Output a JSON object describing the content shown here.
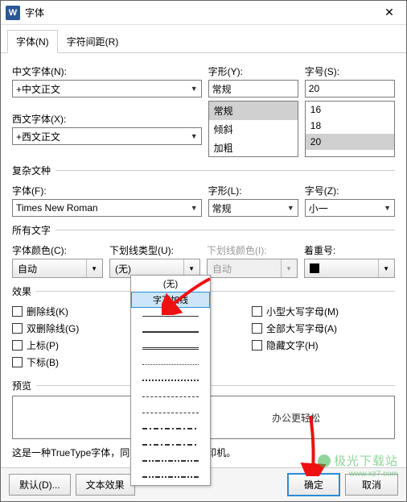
{
  "window": {
    "title": "字体",
    "icon_letter": "W"
  },
  "tabs": [
    {
      "label": "字体(N)",
      "active": true
    },
    {
      "label": "字符间距(R)",
      "active": false
    }
  ],
  "group_main": {
    "cn_font_label": "中文字体(N):",
    "cn_font_value": "+中文正文",
    "style_label": "字形(Y):",
    "style_value": "常规",
    "style_options": [
      "常规",
      "倾斜",
      "加粗"
    ],
    "size_label": "字号(S):",
    "size_value": "20",
    "size_options": [
      "16",
      "18",
      "20"
    ],
    "western_font_label": "西文字体(X):",
    "western_font_value": "+西文正文"
  },
  "group_complex": {
    "title": "复杂文种",
    "font_label": "字体(F):",
    "font_value": "Times New Roman",
    "style_label": "字形(L):",
    "style_value": "常规",
    "size_label": "字号(Z):",
    "size_value": "小一"
  },
  "group_allchar": {
    "title": "所有文字",
    "font_color_label": "字体颜色(C):",
    "font_color_value": "自动",
    "underline_type_label": "下划线类型(U):",
    "underline_type_value": "(无)",
    "underline_color_label": "下划线颜色(I):",
    "underline_color_value": "自动",
    "emphasis_label": "着重号:",
    "emphasis_value": "."
  },
  "underline_dropdown": {
    "none": "(无)",
    "word_only": "字下加线"
  },
  "group_effects": {
    "title": "效果",
    "strike": "删除线(K)",
    "dstrike": "双删除线(G)",
    "superscript": "上标(P)",
    "subscript": "下标(B)",
    "smallcaps": "小型大写字母(M)",
    "allcaps": "全部大写字母(A)",
    "hidden": "隐藏文字(H)"
  },
  "preview": {
    "title": "预览",
    "text": "办公更轻松",
    "note": "这是一种TrueType字体，同时适用于屏幕和打印机。"
  },
  "buttons": {
    "default": "默认(D)...",
    "text_effects": "文本效果",
    "ok": "确定",
    "cancel": "取消"
  },
  "watermark": {
    "text": "极光下载站",
    "url": "www.xz7.com"
  }
}
